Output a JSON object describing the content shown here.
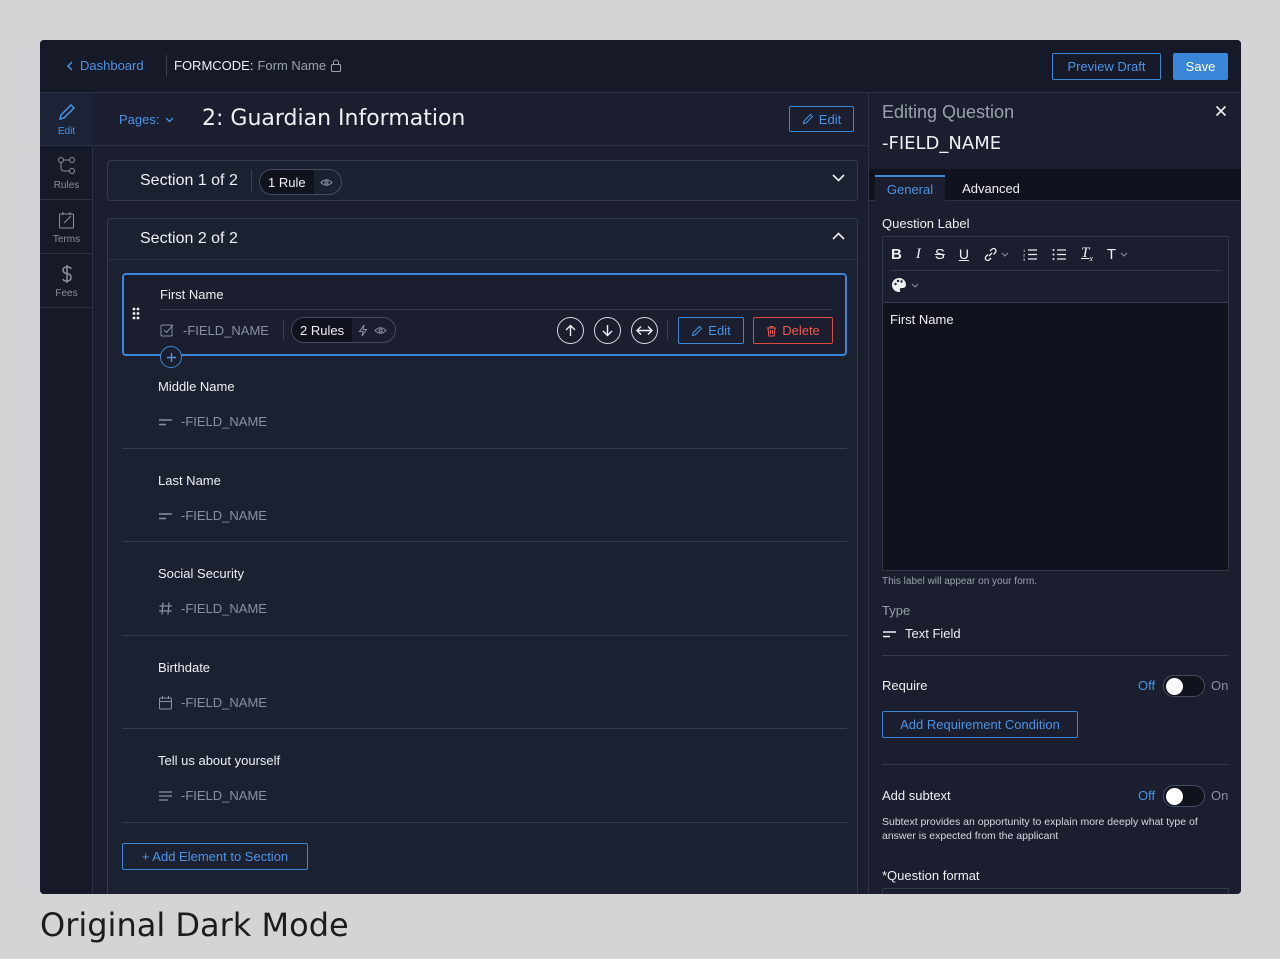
{
  "topbar": {
    "back_label": "Dashboard",
    "formcode_label": "FORMCODE:",
    "form_name": "Form Name",
    "preview_label": "Preview Draft",
    "save_label": "Save"
  },
  "rail": {
    "items": [
      {
        "label": "Edit",
        "icon": "pencil-icon",
        "active": true
      },
      {
        "label": "Rules",
        "icon": "rules-icon",
        "active": false
      },
      {
        "label": "Terms",
        "icon": "terms-icon",
        "active": false
      },
      {
        "label": "Fees",
        "icon": "dollar-icon",
        "active": false
      }
    ]
  },
  "main": {
    "pages_label": "Pages:",
    "page_title": "2: Guardian Information",
    "edit_label": "Edit",
    "sections": [
      {
        "title": "Section 1 of 2",
        "rules": "1 Rule"
      },
      {
        "title": "Section 2 of 2"
      }
    ],
    "selected_question": {
      "label": "First Name",
      "field": "-FIELD_NAME",
      "rules": "2 Rules",
      "edit_label": "Edit",
      "delete_label": "Delete"
    },
    "questions": [
      {
        "label": "Middle Name",
        "field": "-FIELD_NAME",
        "icon": "text-field-icon"
      },
      {
        "label": "Last Name",
        "field": "-FIELD_NAME",
        "icon": "text-field-icon"
      },
      {
        "label": "Social Security",
        "field": "-FIELD_NAME",
        "icon": "hash-icon"
      },
      {
        "label": "Birthdate",
        "field": "-FIELD_NAME",
        "icon": "calendar-icon"
      },
      {
        "label": "Tell us about yourself",
        "field": "-FIELD_NAME",
        "icon": "textarea-icon"
      }
    ],
    "add_element_label": "+ Add Element to Section"
  },
  "panel": {
    "editing_label": "Editing Question",
    "field_name": "-FIELD_NAME",
    "tabs": [
      "General",
      "Advanced"
    ],
    "question_label_title": "Question Label",
    "editor_text": "First Name",
    "hint": "This label will appear on your form.",
    "type_label": "Type",
    "type_value": "Text Field",
    "require_label": "Require",
    "off_label": "Off",
    "on_label": "On",
    "add_requirement_label": "Add Requirement Condition",
    "add_subtext_label": "Add subtext",
    "subtext_desc": "Subtext provides an opportunity to explain more deeply what type of answer is expected from the applicant",
    "question_format_label": "*Question format"
  },
  "caption": "Original Dark Mode",
  "colors": {
    "accent": "#3a86d8",
    "danger": "#e04a3e",
    "background": "#1a1e2e"
  }
}
